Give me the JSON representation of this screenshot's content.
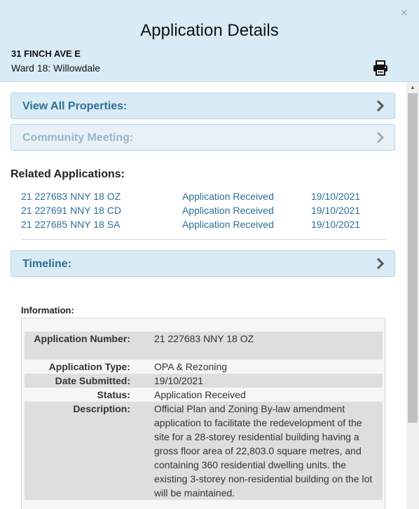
{
  "header": {
    "title": "Application Details",
    "address": "31 FINCH AVE E",
    "ward": "Ward 18: Willowdale",
    "close_symbol": "×"
  },
  "panels": {
    "view_all_properties": "View All Properties:",
    "community_meeting": "Community Meeting:",
    "timeline": "Timeline:"
  },
  "related": {
    "heading": "Related Applications:",
    "rows": [
      {
        "number": "21 227683 NNY 18 OZ",
        "status": "Application Received",
        "date": "19/10/2021"
      },
      {
        "number": "21 227691 NNY 18 CD",
        "status": "Application Received",
        "date": "19/10/2021"
      },
      {
        "number": "21 227685 NNY 18 SA",
        "status": "Application Received",
        "date": "19/10/2021"
      }
    ]
  },
  "info": {
    "heading": "Information:",
    "rows": [
      {
        "label": "Application Number:",
        "value": "21 227683 NNY 18 OZ"
      },
      {
        "label": "Application Type:",
        "value": "OPA & Rezoning"
      },
      {
        "label": "Date Submitted:",
        "value": "19/10/2021"
      },
      {
        "label": "Status:",
        "value": "Application Received"
      },
      {
        "label": "Description:",
        "value": "Official Plan and Zoning By-law amendment application to facilitate the redevelopment of the site for a 28-storey residential building having a gross floor area of 22,803.0 square metres, and containing 360 residential dwelling units. the existing 3-storey non-residential building on the lot will be maintained."
      }
    ]
  },
  "icons": {
    "close": "close-icon",
    "print": "printer-icon",
    "chevron": "chevron-right-icon"
  },
  "colors": {
    "header_bg": "#d9ebf5",
    "link": "#2f6f96",
    "panel_label": "#2f6f96",
    "disabled_label": "#97b6c8"
  }
}
